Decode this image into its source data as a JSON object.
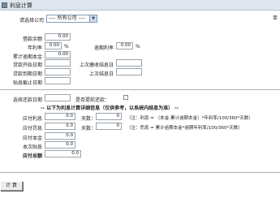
{
  "window": {
    "title": "利息计算",
    "corner_mark": "单"
  },
  "company_select": {
    "label": "请选择公司",
    "value": "---- 所有公司 ----"
  },
  "principal": {
    "balance_label": "借款余额",
    "balance_value": "0.00",
    "annual_rate_label": "年利率",
    "annual_rate_value": "0.00",
    "annual_rate_unit": "%",
    "overdue_rate_label": "逾期利率",
    "overdue_rate_value": "0.00",
    "overdue_rate_unit": "%",
    "cumulative_overdue_label": "累计逾期本金",
    "cumulative_overdue_value": "0.00"
  },
  "dates": {
    "loan_start_label": "贷款开始日期",
    "loan_start_value": "",
    "last_interest_label": "上次缴收结息日",
    "last_interest_value": "",
    "loan_end_label": "贷款到期日期",
    "loan_end_value": "",
    "last_settle_label": "上次结息日",
    "last_settle_value": "",
    "interest_cutoff_label": "贴息截止日期",
    "interest_cutoff_value": ""
  },
  "repayment": {
    "date_label": "选择还款日期",
    "date_value": "",
    "early_label": "是否提前还款："
  },
  "detail_heading": "--  以下为利息计算详细信息（仅供参考，以系统内结息为准） --",
  "results": {
    "interest_due_label": "应付利息",
    "interest_due_value": "0.0",
    "days1_label": "天数：",
    "days1_value": "0",
    "formula1": "（注：利息 = （本金-累计逾期本金）*年利率/100/360*天数）",
    "penalty_due_label": "应付罚息",
    "penalty_due_value": "0.0",
    "days2_label": "天数：",
    "days2_value": "0",
    "formula2": "（注：罚息 = 累计逾期本金*逾期年利率/100/360*天数）",
    "principal_due_label": "应付本金",
    "principal_due_value": "0.0",
    "current_interest_label": "本次贴息",
    "current_interest_value": "0.0",
    "total_due_label": "应付总额",
    "total_due_value": "0.0"
  },
  "buttons": {
    "calculate": "计 算"
  }
}
